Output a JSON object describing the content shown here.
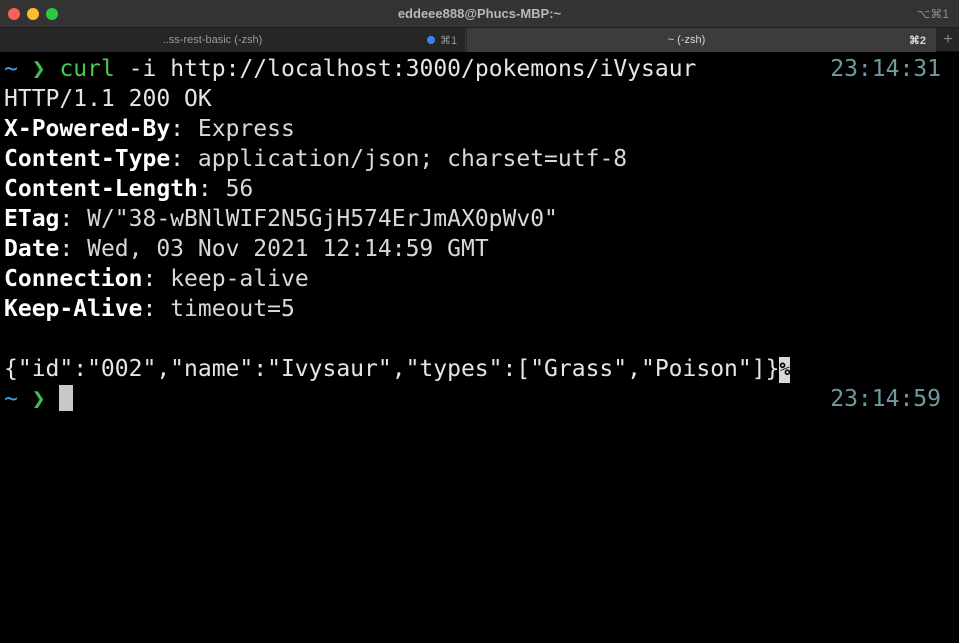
{
  "window": {
    "title": "eddeee888@Phucs-MBP:~",
    "shortcut": "⌥⌘1"
  },
  "tabs": [
    {
      "label": "..ss-rest-basic (-zsh)",
      "shortcut": "⌘1",
      "active": false,
      "indicator_color": "#3b82f6"
    },
    {
      "label": "~ (-zsh)",
      "shortcut": "⌘2",
      "active": true
    }
  ],
  "new_tab_label": "+",
  "terminal": {
    "prompt_dir": "~",
    "prompt_symbol": "❯",
    "command": {
      "name": "curl",
      "args": " -i http://localhost:3000/pokemons/iVysaur",
      "time": "23:14:31"
    },
    "status_line": "HTTP/1.1 200 OK",
    "headers": [
      {
        "key": "X-Powered-By",
        "value": " Express"
      },
      {
        "key": "Content-Type",
        "value": " application/json; charset=utf-8"
      },
      {
        "key": "Content-Length",
        "value": " 56"
      },
      {
        "key": "ETag",
        "value": " W/\"38-wBNlWIF2N5GjH574ErJmAX0pWv0\""
      },
      {
        "key": "Date",
        "value": " Wed, 03 Nov 2021 12:14:59 GMT"
      },
      {
        "key": "Connection",
        "value": " keep-alive"
      },
      {
        "key": "Keep-Alive",
        "value": " timeout=5"
      }
    ],
    "body": "{\"id\":\"002\",\"name\":\"Ivysaur\",\"types\":[\"Grass\",\"Poison\"]}",
    "no_newline_marker": "%",
    "current_prompt_time": "23:14:59"
  },
  "colors": {
    "prompt_dir": "#3ba5e8",
    "prompt_symbol": "#3fbf4e",
    "command": "#4ac94f",
    "rprompt": "#6e9aa0"
  }
}
